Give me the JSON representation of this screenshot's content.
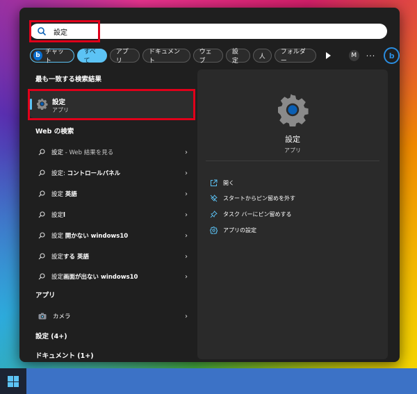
{
  "search": {
    "value": "設定",
    "placeholder": ""
  },
  "filters": {
    "chat": "チャット",
    "all": "すべて",
    "apps": "アプリ",
    "documents": "ドキュメント",
    "web": "ウェブ",
    "settings": "設定",
    "people": "人",
    "folders": "フォルダー",
    "avatar": "M",
    "more": "···"
  },
  "sections": {
    "best_match": "最も一致する検索結果",
    "web_search": "Web の検索",
    "apps": "アプリ",
    "settings_count": "設定 (4+)",
    "documents_count": "ドキュメント (1+)"
  },
  "best_match": {
    "name": "設定",
    "type": "アプリ"
  },
  "web_results": [
    {
      "main": "設定",
      "muted": " - Web 結果を見る",
      "bold": ""
    },
    {
      "main": "設定: ",
      "muted": "",
      "bold": "コントロールパネル"
    },
    {
      "main": "設定 ",
      "muted": "",
      "bold": "英語"
    },
    {
      "main": "設定",
      "muted": "",
      "bold": "l"
    },
    {
      "main": "設定 ",
      "muted": "",
      "bold": "開かない windows10"
    },
    {
      "main": "設定",
      "muted": "",
      "bold": "する 英語"
    },
    {
      "main": "設定",
      "muted": "",
      "bold": "画面が出ない windows10"
    }
  ],
  "app_results": [
    {
      "name": "カメラ"
    }
  ],
  "detail": {
    "name": "設定",
    "type": "アプリ",
    "actions": [
      {
        "label": "開く",
        "icon": "open-external-icon"
      },
      {
        "label": "スタートからピン留めを外す",
        "icon": "unpin-icon"
      },
      {
        "label": "タスク バーにピン留めする",
        "icon": "pin-icon"
      },
      {
        "label": "アプリの設定",
        "icon": "gear-icon"
      }
    ]
  },
  "colors": {
    "accent": "#5cc3f5",
    "highlight": "#e0001a",
    "panel": "#1f1f1f",
    "taskbar": "#3c72c6"
  }
}
